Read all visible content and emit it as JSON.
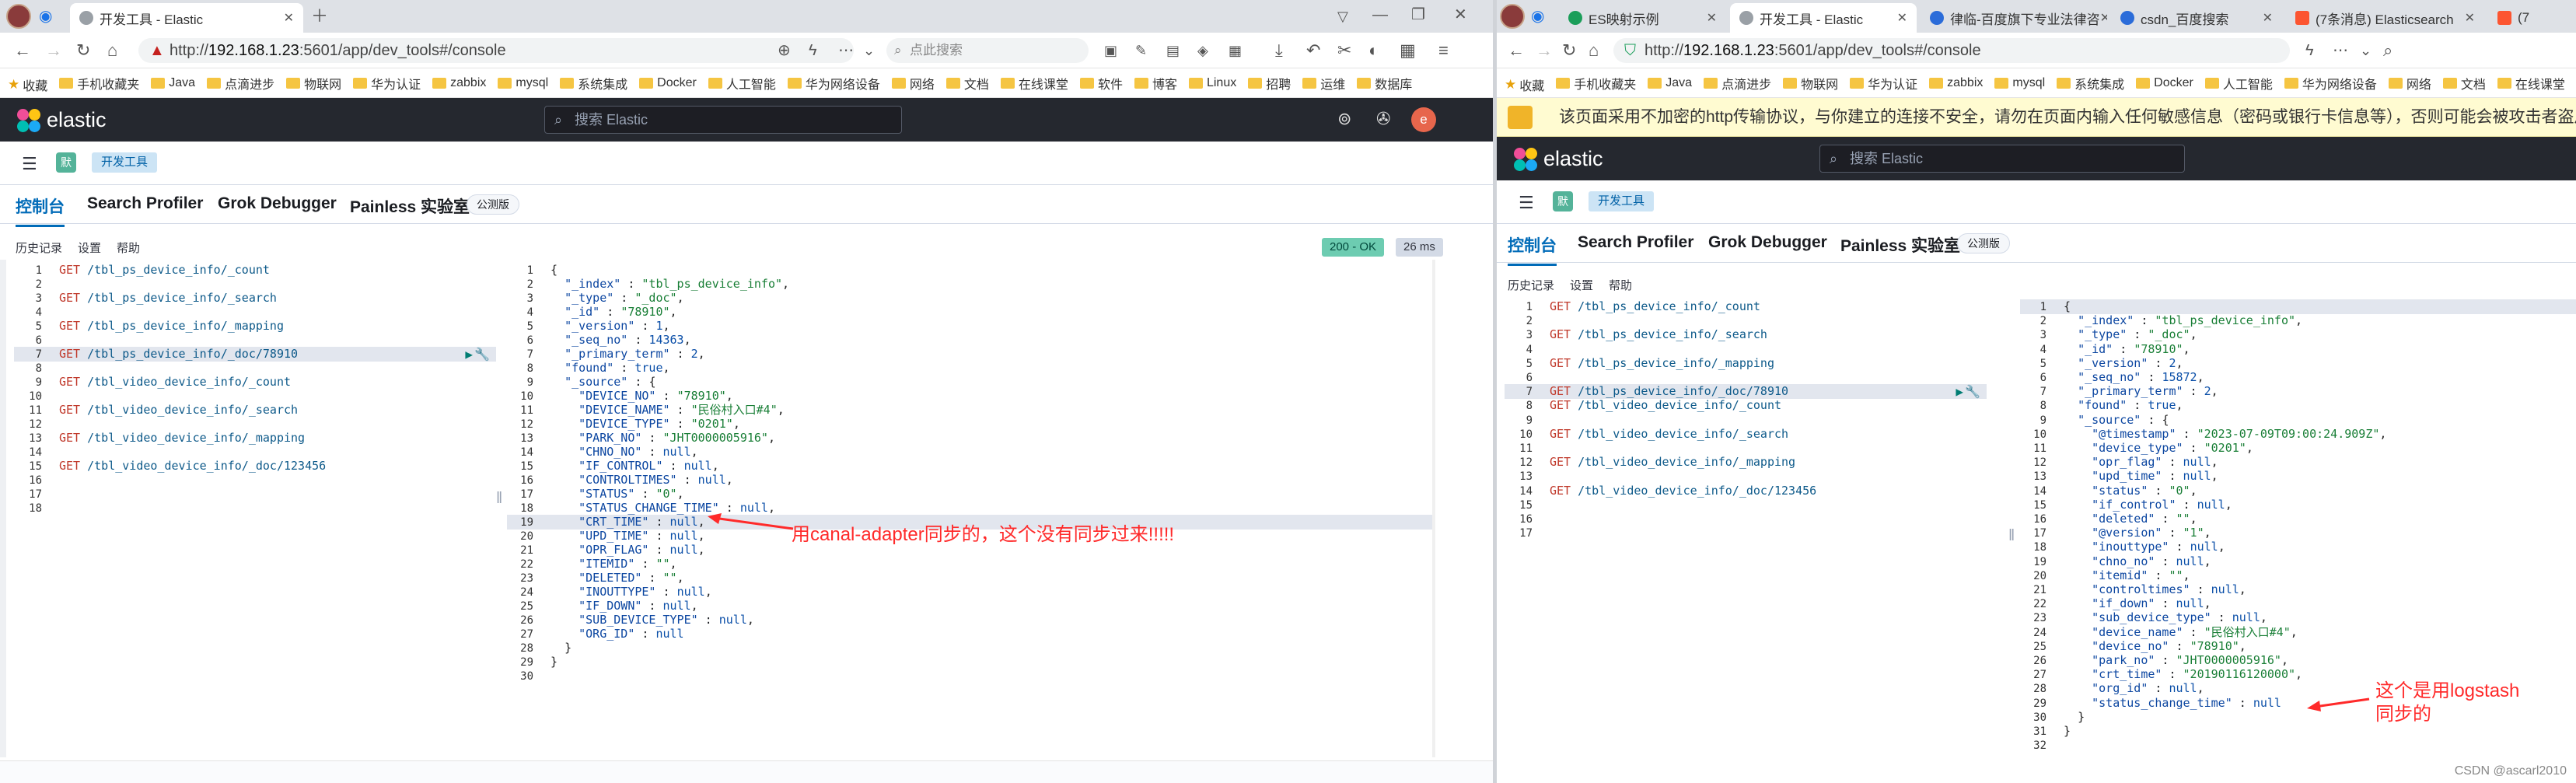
{
  "left": {
    "tabs": [
      {
        "label": "开发工具 - Elastic",
        "active": true
      }
    ],
    "url": {
      "prefix": "http://",
      "host": "192.168.1.23",
      "rest": ":5601/app/dev_tools#/console"
    },
    "search_placeholder": "点此搜索",
    "bookmarks": [
      "收藏",
      "手机收藏夹",
      "Java",
      "点滴进步",
      "物联网",
      "华为认证",
      "zabbix",
      "mysql",
      "系统集成",
      "Docker",
      "人工智能",
      "华为网络设备",
      "网络",
      "文档",
      "在线课堂",
      "软件",
      "博客",
      "Linux",
      "招聘",
      "运维",
      "数据库"
    ],
    "elastic": {
      "brand": "elastic",
      "search_placeholder": "搜索 Elastic",
      "avatar": "e"
    },
    "breadcrumb": {
      "space": "默",
      "page": "开发工具"
    },
    "devtabs": [
      "控制台",
      "Search Profiler",
      "Grok Debugger",
      "Painless 实验室"
    ],
    "beta": "公测版",
    "sub": [
      "历史记录",
      "设置",
      "帮助"
    ],
    "status": {
      "code": "200 - OK",
      "time": "26 ms"
    },
    "requests": [
      {
        "n": "1",
        "m": "GET",
        "p": " /tbl_ps_device_info/_count"
      },
      {
        "n": "2",
        "m": "",
        "p": ""
      },
      {
        "n": "3",
        "m": "GET",
        "p": " /tbl_ps_device_info/_search"
      },
      {
        "n": "4",
        "m": "",
        "p": ""
      },
      {
        "n": "5",
        "m": "GET",
        "p": " /tbl_ps_device_info/_mapping"
      },
      {
        "n": "6",
        "m": "",
        "p": ""
      },
      {
        "n": "7",
        "m": "GET",
        "p": " /tbl_ps_device_info/_doc/78910"
      },
      {
        "n": "8",
        "m": "",
        "p": ""
      },
      {
        "n": "9",
        "m": "GET",
        "p": " /tbl_video_device_info/_count"
      },
      {
        "n": "10",
        "m": "",
        "p": ""
      },
      {
        "n": "11",
        "m": "GET",
        "p": " /tbl_video_device_info/_search"
      },
      {
        "n": "12",
        "m": "",
        "p": ""
      },
      {
        "n": "13",
        "m": "GET",
        "p": " /tbl_video_device_info/_mapping"
      },
      {
        "n": "14",
        "m": "",
        "p": ""
      },
      {
        "n": "15",
        "m": "GET",
        "p": " /tbl_video_device_info/_doc/123456"
      },
      {
        "n": "16",
        "m": "",
        "p": ""
      },
      {
        "n": "17",
        "m": "",
        "p": ""
      },
      {
        "n": "18",
        "m": "",
        "p": ""
      }
    ],
    "response": [
      "{",
      "  \"_index\" : \"tbl_ps_device_info\",",
      "  \"_type\" : \"_doc\",",
      "  \"_id\" : \"78910\",",
      "  \"_version\" : 1,",
      "  \"_seq_no\" : 14363,",
      "  \"_primary_term\" : 2,",
      "  \"found\" : true,",
      "  \"_source\" : {",
      "    \"DEVICE_NO\" : \"78910\",",
      "    \"DEVICE_NAME\" : \"民俗村入口#4\",",
      "    \"DEVICE_TYPE\" : \"0201\",",
      "    \"PARK_NO\" : \"JHT0000005916\",",
      "    \"CHNO_NO\" : null,",
      "    \"IF_CONTROL\" : null,",
      "    \"CONTROLTIMES\" : null,",
      "    \"STATUS\" : \"0\",",
      "    \"STATUS_CHANGE_TIME\" : null,",
      "    \"CRT_TIME\" : null,",
      "    \"UPD_TIME\" : null,",
      "    \"OPR_FLAG\" : null,",
      "    \"ITEMID\" : \"\",",
      "    \"DELETED\" : \"\",",
      "    \"INOUTTYPE\" : null,",
      "    \"IF_DOWN\" : null,",
      "    \"SUB_DEVICE_TYPE\" : null,",
      "    \"ORG_ID\" : null",
      "  }",
      "}",
      ""
    ],
    "annotation": "用canal-adapter同步的，这个没有同步过来!!!!!"
  },
  "right": {
    "tabs": [
      {
        "label": "ES映射示例",
        "active": false
      },
      {
        "label": "开发工具 - Elastic",
        "active": true
      },
      {
        "label": "律临-百度旗下专业法律咨",
        "active": false
      },
      {
        "label": "csdn_百度搜索",
        "active": false
      },
      {
        "label": "(7条消息) Elasticsearch",
        "active": false
      },
      {
        "label": "(7",
        "active": false
      }
    ],
    "url": {
      "prefix": "http://",
      "host": "192.168.1.23",
      "rest": ":5601/app/dev_tools#/console"
    },
    "bookmarks": [
      "收藏",
      "手机收藏夹",
      "Java",
      "点滴进步",
      "物联网",
      "华为认证",
      "zabbix",
      "mysql",
      "系统集成",
      "Docker",
      "人工智能",
      "华为网络设备",
      "网络",
      "文档",
      "在线课堂"
    ],
    "warning": "该页面采用不加密的http传输协议，与你建立的连接不安全，请勿在页面内输入任何敏感信息（密码或银行卡信息等），否则可能会被攻击者盗用",
    "elastic": {
      "brand": "elastic",
      "search_placeholder": "搜索 Elastic"
    },
    "breadcrumb": {
      "space": "默",
      "page": "开发工具"
    },
    "devtabs": [
      "控制台",
      "Search Profiler",
      "Grok Debugger",
      "Painless 实验室"
    ],
    "beta": "公测版",
    "sub": [
      "历史记录",
      "设置",
      "帮助"
    ],
    "requests": [
      {
        "n": "1",
        "m": "GET",
        "p": " /tbl_ps_device_info/_count"
      },
      {
        "n": "2",
        "m": "",
        "p": ""
      },
      {
        "n": "3",
        "m": "GET",
        "p": " /tbl_ps_device_info/_search"
      },
      {
        "n": "4",
        "m": "",
        "p": ""
      },
      {
        "n": "5",
        "m": "GET",
        "p": " /tbl_ps_device_info/_mapping"
      },
      {
        "n": "6",
        "m": "",
        "p": ""
      },
      {
        "n": "7",
        "m": "GET",
        "p": " /tbl_ps_device_info/_doc/78910"
      },
      {
        "n": "8",
        "m": "GET",
        "p": " /tbl_video_device_info/_count"
      },
      {
        "n": "9",
        "m": "",
        "p": ""
      },
      {
        "n": "10",
        "m": "GET",
        "p": " /tbl_video_device_info/_search"
      },
      {
        "n": "11",
        "m": "",
        "p": ""
      },
      {
        "n": "12",
        "m": "GET",
        "p": " /tbl_video_device_info/_mapping"
      },
      {
        "n": "13",
        "m": "",
        "p": ""
      },
      {
        "n": "14",
        "m": "GET",
        "p": " /tbl_video_device_info/_doc/123456"
      },
      {
        "n": "15",
        "m": "",
        "p": ""
      },
      {
        "n": "16",
        "m": "",
        "p": ""
      },
      {
        "n": "17",
        "m": "",
        "p": ""
      }
    ],
    "response": [
      "{",
      "  \"_index\" : \"tbl_ps_device_info\",",
      "  \"_type\" : \"_doc\",",
      "  \"_id\" : \"78910\",",
      "  \"_version\" : 2,",
      "  \"_seq_no\" : 15872,",
      "  \"_primary_term\" : 2,",
      "  \"found\" : true,",
      "  \"_source\" : {",
      "    \"@timestamp\" : \"2023-07-09T09:00:24.909Z\",",
      "    \"device_type\" : \"0201\",",
      "    \"opr_flag\" : null,",
      "    \"upd_time\" : null,",
      "    \"status\" : \"0\",",
      "    \"if_control\" : null,",
      "    \"deleted\" : \"\",",
      "    \"@version\" : \"1\",",
      "    \"inouttype\" : null,",
      "    \"chno_no\" : null,",
      "    \"itemid\" : \"\",",
      "    \"controltimes\" : null,",
      "    \"if_down\" : null,",
      "    \"sub_device_type\" : null,",
      "    \"device_name\" : \"民俗村入口#4\",",
      "    \"device_no\" : \"78910\",",
      "    \"park_no\" : \"JHT0000005916\",",
      "    \"crt_time\" : \"20190116120000\",",
      "    \"org_id\" : null,",
      "    \"status_change_time\" : null",
      "  }",
      "}",
      ""
    ],
    "annotation_line1": "这个是用logstash",
    "annotation_line2": "同步的",
    "watermark": "CSDN @ascarl2010"
  }
}
